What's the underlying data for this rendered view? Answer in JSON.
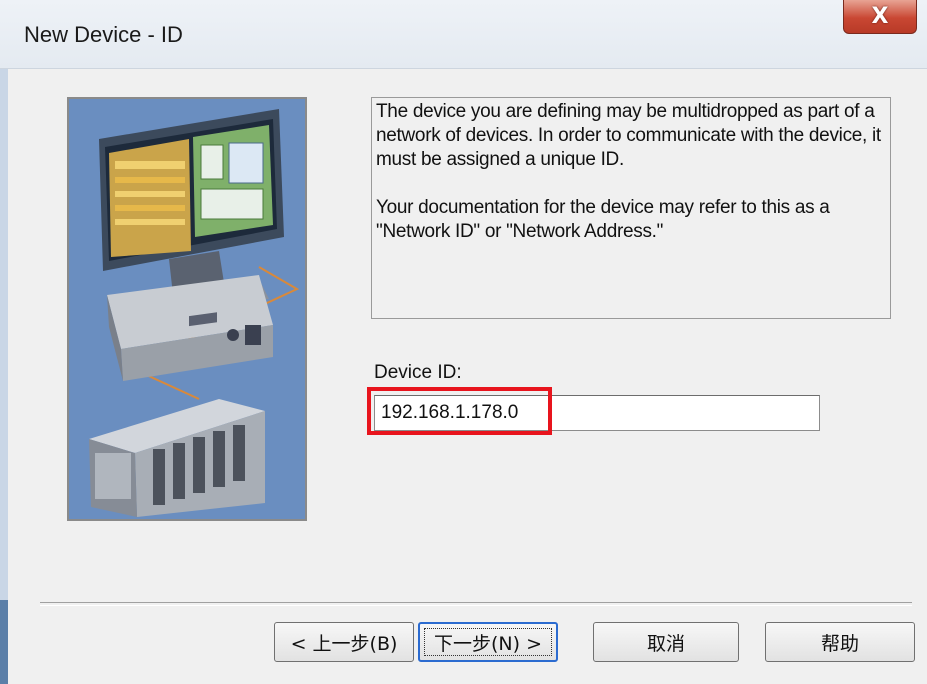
{
  "window": {
    "title": "New Device - ID",
    "close_glyph": "X"
  },
  "info": {
    "paragraph1": "The device you are defining may be multidropped as part of a network of devices.  In order to communicate with the device, it must be assigned a unique ID.",
    "paragraph2": "Your documentation for the device may refer to this as a \"Network ID\" or \"Network Address.\""
  },
  "device_id": {
    "label": "Device ID:",
    "value": "192.168.1.178.0"
  },
  "buttons": {
    "back": "< 上一步(B)",
    "next": "下一步(N) >",
    "cancel": "取消",
    "help": "帮助"
  },
  "colors": {
    "highlight": "#e8141d",
    "illustration_bg": "#6a8ec0",
    "close_button": "#c94733"
  },
  "icons": {
    "illustration": "computer-and-plc-illustration",
    "close": "close-icon"
  }
}
